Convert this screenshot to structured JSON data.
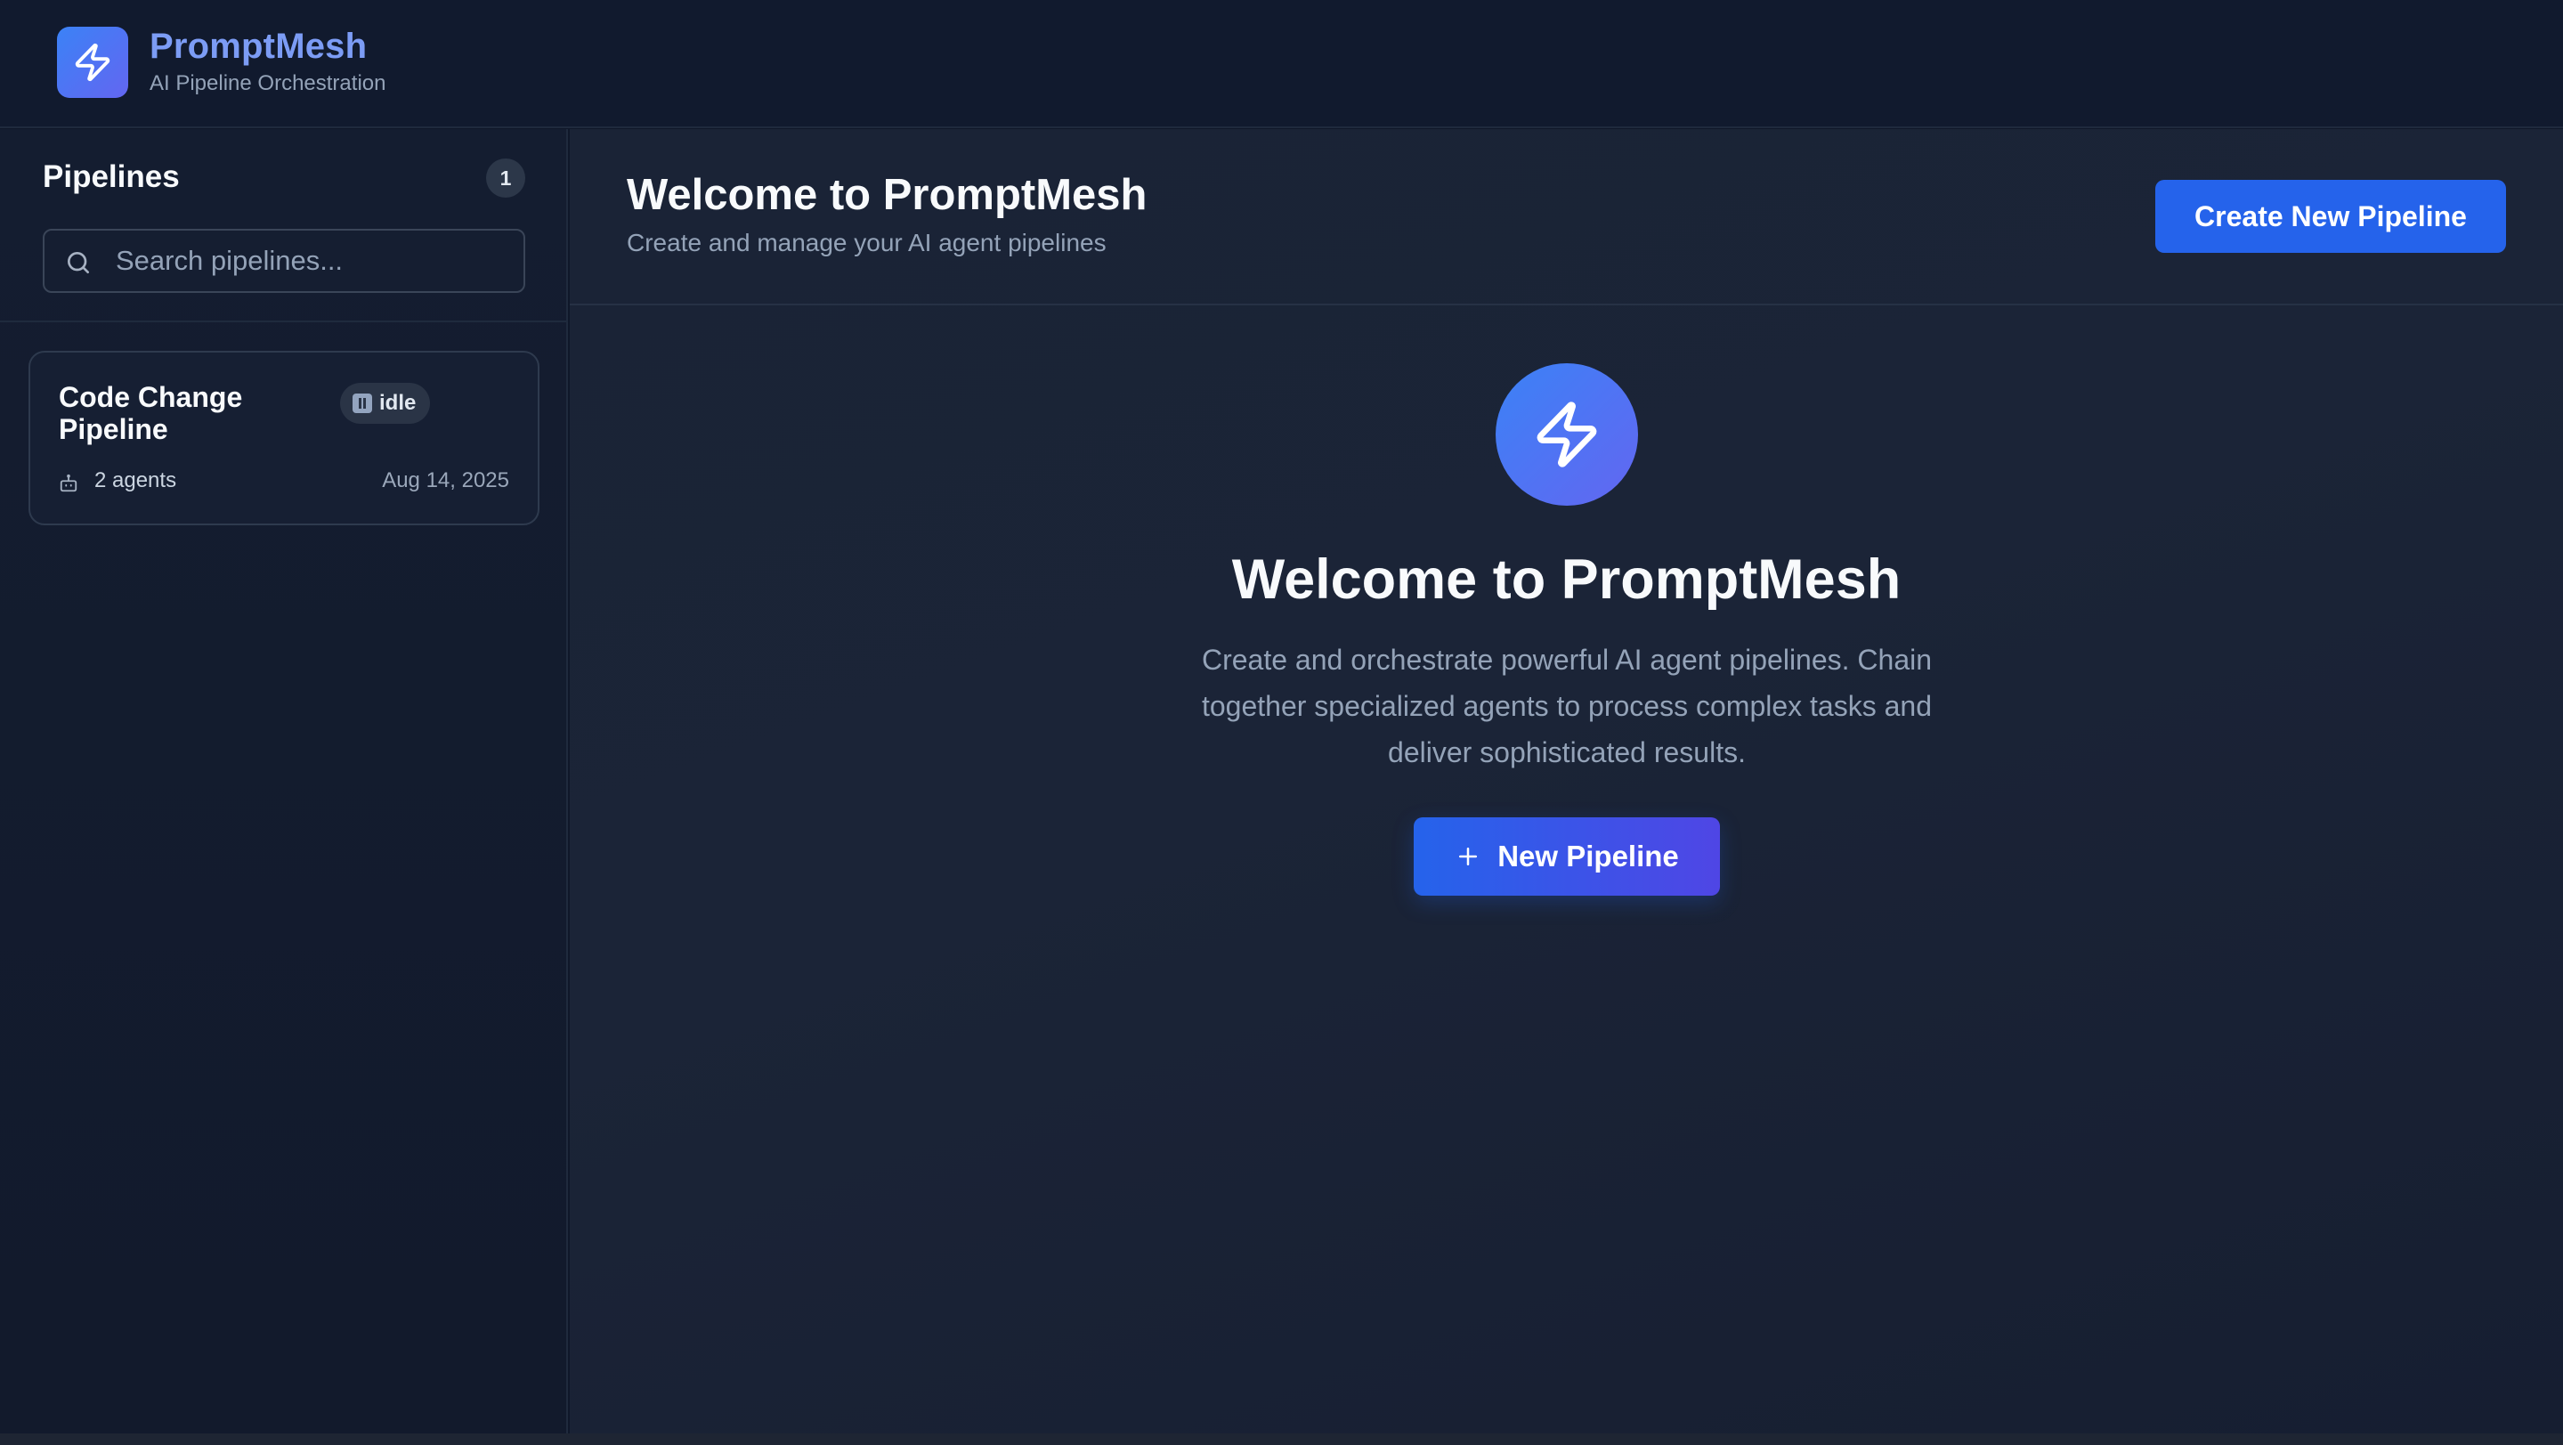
{
  "app": {
    "name": "PromptMesh",
    "tagline": "AI Pipeline Orchestration",
    "logo_icon": "lightning-bolt-icon",
    "accent_color": "#2563eb",
    "gradient": [
      "#3b82f6",
      "#6366f1"
    ]
  },
  "sidebar": {
    "title": "Pipelines",
    "count": "1",
    "search": {
      "placeholder": "Search pipelines...",
      "value": "",
      "icon": "search-icon"
    },
    "pipelines": [
      {
        "name": "Code Change Pipeline",
        "status": "idle",
        "status_icon": "pause-icon",
        "agents": "2 agents",
        "agents_icon": "robot-icon",
        "date": "Aug 14, 2025"
      }
    ]
  },
  "main": {
    "header": {
      "title": "Welcome to PromptMesh",
      "subtitle": "Create and manage your AI agent pipelines",
      "create_button": "Create New Pipeline"
    },
    "hero": {
      "icon": "lightning-bolt-icon",
      "title": "Welcome to PromptMesh",
      "description": "Create and orchestrate powerful AI agent pipelines. Chain together specialized agents to process complex tasks and deliver sophisticated results.",
      "button": "New Pipeline",
      "button_icon": "plus-icon"
    }
  }
}
